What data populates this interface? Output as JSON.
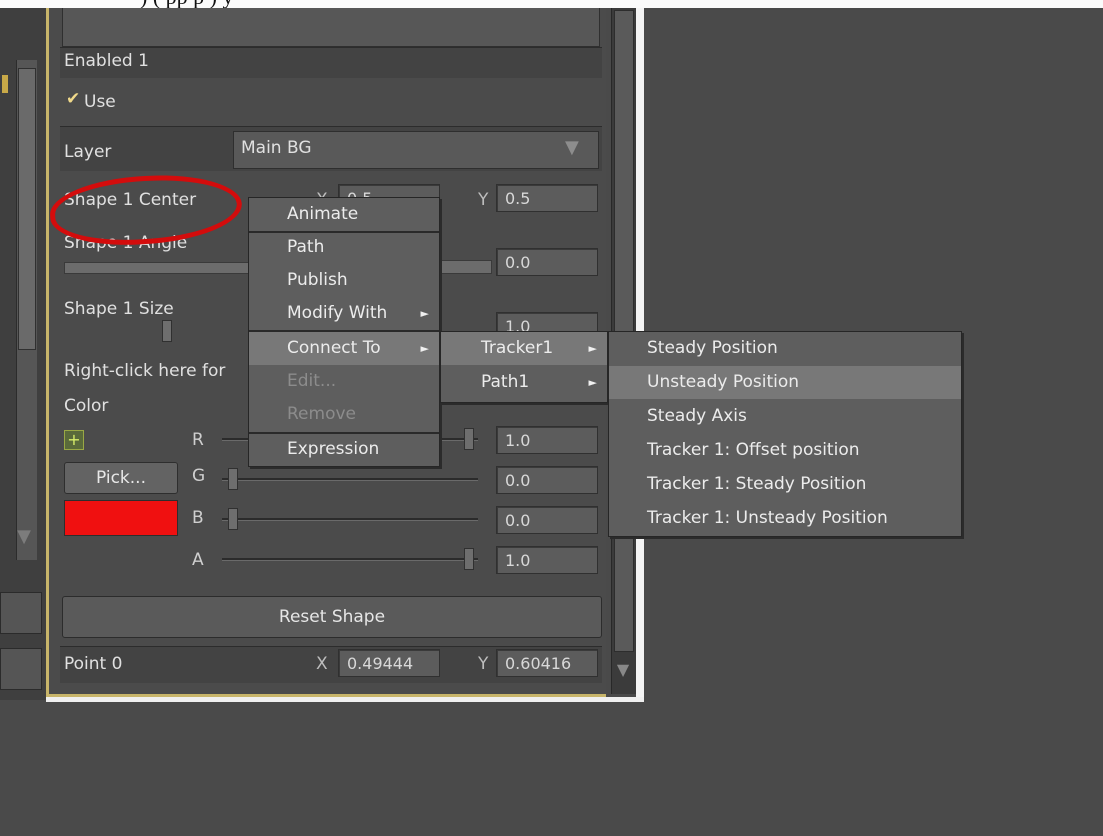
{
  "top_strip_text": ")                                    (   pp p         )               y",
  "panel": {
    "enabled_label": "Enabled 1",
    "use_label": "Use",
    "use_check": "✔",
    "layer_label": "Layer",
    "layer_value": "Main BG",
    "layer_arrow": "▼",
    "shape_center_label": "Shape 1 Center",
    "shape_center_x_label": "X",
    "shape_center_x_value": "0.5",
    "shape_center_y_label": "Y",
    "shape_center_y_value": "0.5",
    "shape_angle_label": "Shape 1 Angle",
    "shape_angle_value": "0.0",
    "shape_size_label": "Shape 1 Size",
    "shape_size_value": "1.0",
    "right_click_hint": "Right-click here for",
    "color_label": "Color",
    "plus_icon": "+",
    "pick_button": "Pick...",
    "r_label": "R",
    "r_value": "1.0",
    "g_label": "G",
    "g_value": "0.0",
    "b_label": "B",
    "b_value": "0.0",
    "a_label": "A",
    "a_value": "1.0",
    "swatch_color": "#f01010",
    "reset_button": "Reset Shape",
    "point_label": "Point 0",
    "point_x_label": "X",
    "point_x_value": "0.49444",
    "point_y_label": "Y",
    "point_y_value": "0.60416"
  },
  "context_menu": {
    "items": [
      "Animate",
      "Path",
      "Publish",
      "Modify With",
      "Connect To",
      "Edit...",
      "Remove",
      "Expression"
    ],
    "submenu_arrow": "►"
  },
  "connect_submenu": {
    "items": [
      "Tracker1",
      "Path1"
    ]
  },
  "tracker_submenu": {
    "items": [
      "Steady Position",
      "Unsteady Position",
      "Steady Axis",
      "Tracker 1: Offset position",
      "Tracker 1: Steady Position",
      "Tracker 1: Unsteady Position"
    ]
  },
  "colors": {
    "background": "#4a4a4a",
    "panel_border": "#c8b56a",
    "annotation_red": "#d30c0c",
    "menu_highlight": "#787878"
  }
}
